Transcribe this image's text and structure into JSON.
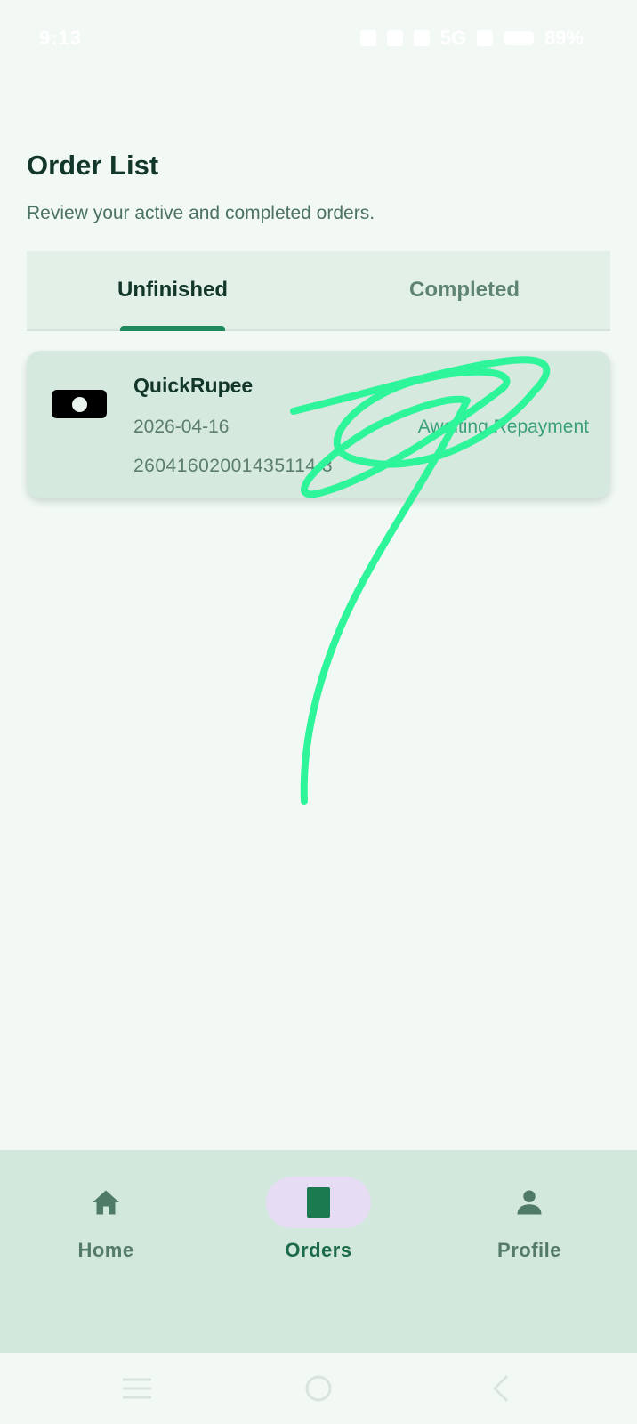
{
  "status_bar": {
    "time": "9:13",
    "network": "5G",
    "battery": "89%"
  },
  "header": {
    "title": "Order List",
    "subtitle": "Review your active and completed orders."
  },
  "tabs": [
    {
      "label": "Unfinished",
      "active": true
    },
    {
      "label": "Completed",
      "active": false
    }
  ],
  "orders": [
    {
      "lender": "QuickRupee",
      "date": "2026-04-16",
      "order_no": "26041602001435114 3",
      "status": "Awaiting Repayment",
      "icon": "cash-icon"
    }
  ],
  "bottom_nav": {
    "items": [
      {
        "label": "Home",
        "icon": "home-icon",
        "active": false
      },
      {
        "label": "Orders",
        "icon": "orders-icon",
        "active": true
      },
      {
        "label": "Profile",
        "icon": "profile-icon",
        "active": false
      }
    ]
  },
  "colors": {
    "accent": "#1f8a5b",
    "background": "#f2f8f4",
    "card": "#d5e9de",
    "nav_bg": "#d3e8dc",
    "active_pill": "#e6dcf4",
    "status_text": "#3aa17a",
    "scribble": "#2ef59a"
  }
}
